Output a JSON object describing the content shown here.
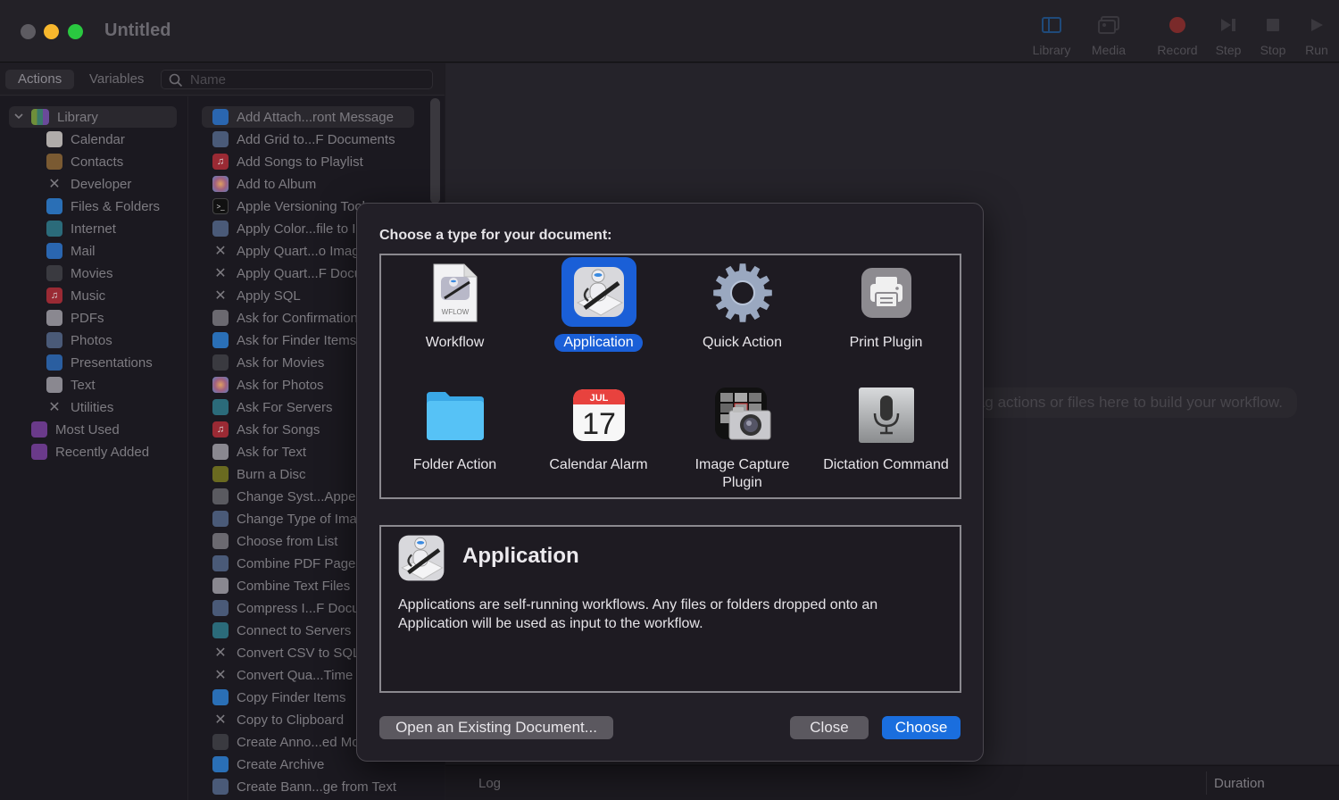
{
  "window": {
    "title": "Untitled"
  },
  "toolbar": [
    {
      "label": "Library",
      "icon": "sidebar-icon"
    },
    {
      "label": "Media",
      "icon": "photos-icon"
    },
    {
      "label": "Record",
      "icon": "record-icon"
    },
    {
      "label": "Step",
      "icon": "step-icon"
    },
    {
      "label": "Stop",
      "icon": "stop-icon"
    },
    {
      "label": "Run",
      "icon": "play-icon"
    }
  ],
  "library": {
    "tabs": [
      "Actions",
      "Variables"
    ],
    "active_tab": "Actions",
    "search": {
      "placeholder": "Name",
      "value": ""
    },
    "categories": [
      {
        "label": "Library",
        "icon": "library-icon",
        "color": "#6f8f3a",
        "expanded": true
      },
      {
        "label": "Calendar",
        "icon": "calendar-icon",
        "color": "#b0acaa"
      },
      {
        "label": "Contacts",
        "icon": "contacts-icon",
        "color": "#7a5a32"
      },
      {
        "label": "Developer",
        "icon": "developer-icon",
        "color": "#6b6970"
      },
      {
        "label": "Files & Folders",
        "icon": "finder-icon",
        "color": "#2a6fb6"
      },
      {
        "label": "Internet",
        "icon": "globe-icon",
        "color": "#2b6b7a"
      },
      {
        "label": "Mail",
        "icon": "mail-icon",
        "color": "#2a66b0"
      },
      {
        "label": "Movies",
        "icon": "quicktime-icon",
        "color": "#3a3a40"
      },
      {
        "label": "Music",
        "icon": "music-icon",
        "color": "#9a2a34"
      },
      {
        "label": "PDFs",
        "icon": "pdf-icon",
        "color": "#8a8890"
      },
      {
        "label": "Photos",
        "icon": "preview-icon",
        "color": "#4a5a78"
      },
      {
        "label": "Presentations",
        "icon": "keynote-icon",
        "color": "#2a5ea0"
      },
      {
        "label": "Text",
        "icon": "textedit-icon",
        "color": "#8a8890"
      },
      {
        "label": "Utilities",
        "icon": "utilities-icon",
        "color": "#6b6970"
      },
      {
        "label": "Most Used",
        "icon": "smart-folder-icon",
        "color": "#6a3a8a"
      },
      {
        "label": "Recently Added",
        "icon": "smart-folder-icon",
        "color": "#6a3a8a"
      }
    ],
    "actions": [
      {
        "label": "Add Attach...ront Message",
        "icon": "mail-icon",
        "color": "#2a66b0"
      },
      {
        "label": "Add Grid to...F Documents",
        "icon": "preview-icon",
        "color": "#4a5a78"
      },
      {
        "label": "Add Songs to Playlist",
        "icon": "music-icon",
        "color": "#9a2a34"
      },
      {
        "label": "Add to Album",
        "icon": "photos-icon",
        "color": "#8a6a50"
      },
      {
        "label": "Apple Versioning Tool",
        "icon": "terminal-icon",
        "color": "#111"
      },
      {
        "label": "Apply Color...file to Images",
        "icon": "preview-icon",
        "color": "#4a5a78"
      },
      {
        "label": "Apply Quart...o Images",
        "icon": "developer-icon",
        "color": "#6b6970"
      },
      {
        "label": "Apply Quart...F Documents",
        "icon": "developer-icon",
        "color": "#6b6970"
      },
      {
        "label": "Apply SQL",
        "icon": "developer-icon",
        "color": "#6b6970"
      },
      {
        "label": "Ask for Confirmation",
        "icon": "automator-icon",
        "color": "#6b6970"
      },
      {
        "label": "Ask for Finder Items",
        "icon": "finder-icon",
        "color": "#2a6fb6"
      },
      {
        "label": "Ask for Movies",
        "icon": "quicktime-icon",
        "color": "#3a3a40"
      },
      {
        "label": "Ask for Photos",
        "icon": "photos-icon",
        "color": "#8a6a50"
      },
      {
        "label": "Ask For Servers",
        "icon": "globe-icon",
        "color": "#2b6b7a"
      },
      {
        "label": "Ask for Songs",
        "icon": "music-icon",
        "color": "#9a2a34"
      },
      {
        "label": "Ask for Text",
        "icon": "textedit-icon",
        "color": "#8a8890"
      },
      {
        "label": "Burn a Disc",
        "icon": "burn-icon",
        "color": "#6a6a20"
      },
      {
        "label": "Change Syst...Appearance",
        "icon": "system-preferences-icon",
        "color": "#5a5a60"
      },
      {
        "label": "Change Type of Images",
        "icon": "preview-icon",
        "color": "#4a5a78"
      },
      {
        "label": "Choose from List",
        "icon": "automator-icon",
        "color": "#6b6970"
      },
      {
        "label": "Combine PDF Pages",
        "icon": "preview-icon",
        "color": "#4a5a78"
      },
      {
        "label": "Combine Text Files",
        "icon": "textedit-icon",
        "color": "#8a8890"
      },
      {
        "label": "Compress I...F Documents",
        "icon": "preview-icon",
        "color": "#4a5a78"
      },
      {
        "label": "Connect to Servers",
        "icon": "globe-icon",
        "color": "#2b6b7a"
      },
      {
        "label": "Convert CSV to SQL",
        "icon": "developer-icon",
        "color": "#6b6970"
      },
      {
        "label": "Convert Qua...Time Movies",
        "icon": "developer-icon",
        "color": "#6b6970"
      },
      {
        "label": "Copy Finder Items",
        "icon": "finder-icon",
        "color": "#2a6fb6"
      },
      {
        "label": "Copy to Clipboard",
        "icon": "developer-icon",
        "color": "#6b6970"
      },
      {
        "label": "Create Anno...ed Movie File",
        "icon": "quicktime-icon",
        "color": "#3a3a40"
      },
      {
        "label": "Create Archive",
        "icon": "finder-icon",
        "color": "#2a6fb6"
      },
      {
        "label": "Create Bann...ge from Text",
        "icon": "preview-icon",
        "color": "#4a5a78"
      }
    ]
  },
  "canvas": {
    "hint": "Drag actions or files here to build your workflow.",
    "log_label": "Log",
    "duration_label": "Duration"
  },
  "dialog": {
    "title": "Choose a type for your document:",
    "types": [
      {
        "label": "Workflow",
        "icon": "workflow-file-icon",
        "badge": "WFLOW"
      },
      {
        "label": "Application",
        "icon": "automator-app-icon",
        "selected": true
      },
      {
        "label": "Quick Action",
        "icon": "gear-icon"
      },
      {
        "label": "Print Plugin",
        "icon": "printer-icon"
      },
      {
        "label": "Folder Action",
        "icon": "folder-icon"
      },
      {
        "label": "Calendar Alarm",
        "icon": "calendar-icon",
        "month": "JUL",
        "day": "17"
      },
      {
        "label": "Image Capture Plugin",
        "icon": "image-capture-icon"
      },
      {
        "label": "Dictation Command",
        "icon": "microphone-icon"
      }
    ],
    "selected_type": "Application",
    "description": {
      "title": "Application",
      "text": "Applications are self-running workflows. Any files or folders dropped onto an Application will be used as input to the workflow."
    },
    "buttons": {
      "open_existing": "Open an Existing Document...",
      "close": "Close",
      "choose": "Choose"
    }
  },
  "colors": {
    "accent": "#1a6ede",
    "selection": "#1a5fd7",
    "record": "#7a2a2a"
  }
}
